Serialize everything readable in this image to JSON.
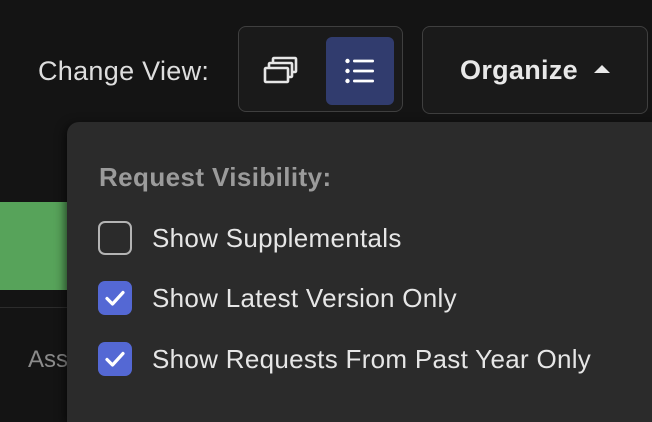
{
  "toolbar": {
    "change_view_label": "Change View:",
    "view_modes": [
      {
        "icon": "cards-stack-icon",
        "selected": false
      },
      {
        "icon": "list-icon",
        "selected": true
      }
    ],
    "organize_label": "Organize",
    "organize_caret": "caret-up-icon"
  },
  "background": {
    "partial_text": "Ass"
  },
  "organize_menu": {
    "heading": "Request Visibility:",
    "options": [
      {
        "label": "Show Supplementals",
        "checked": false
      },
      {
        "label": "Show Latest Version Only",
        "checked": true
      },
      {
        "label": "Show Requests From Past Year Only",
        "checked": true
      }
    ]
  },
  "colors": {
    "accent": "#5468d4",
    "selected_view_bg": "#313c6e",
    "status_green": "#57a35a",
    "menu_bg": "#2b2b2b",
    "page_bg": "#141414"
  }
}
